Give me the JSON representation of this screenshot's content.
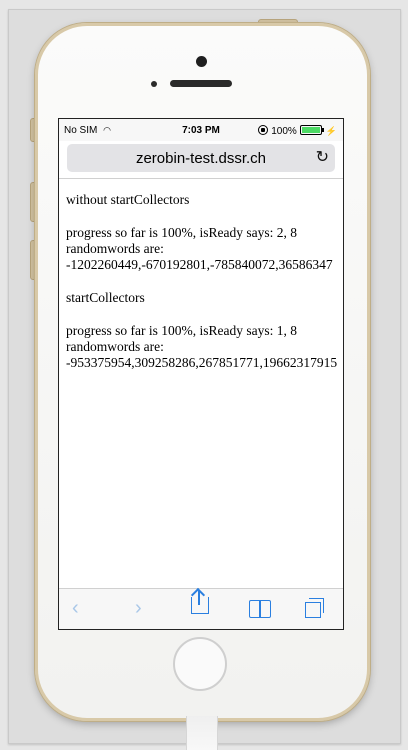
{
  "status_bar": {
    "carrier": "No SIM",
    "time": "7:03 PM",
    "battery": "100%",
    "battery_level": 1.0
  },
  "address_bar": {
    "url": "zerobin-test.dssr.ch",
    "reload_icon": "reload-icon"
  },
  "content": {
    "lines": [
      "without startCollectors",
      "progress so far is 100%, isReady says: 2, 8",
      "randomwords are:",
      "-1202260449,-670192801,-785840072,36586347",
      "startCollectors",
      "progress so far is 100%, isReady says: 1, 8",
      "randomwords are:",
      "-953375954,309258286,267851771,19662317915"
    ]
  },
  "toolbar": {
    "icons": [
      "back-icon",
      "forward-icon",
      "share-icon",
      "bookmarks-icon",
      "tabs-icon"
    ]
  },
  "colors": {
    "accent": "#2a7fe0",
    "battery_fill": "#4cd964"
  }
}
